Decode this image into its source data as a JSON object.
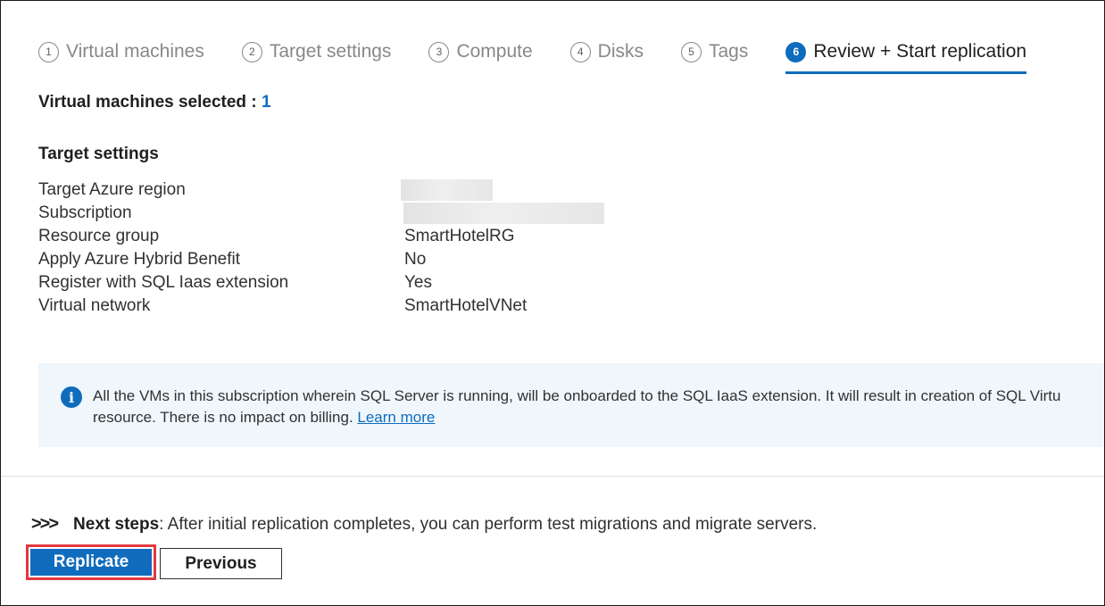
{
  "steps": [
    {
      "num": "1",
      "label": "Virtual machines"
    },
    {
      "num": "2",
      "label": "Target settings"
    },
    {
      "num": "3",
      "label": "Compute"
    },
    {
      "num": "4",
      "label": "Disks"
    },
    {
      "num": "5",
      "label": "Tags"
    },
    {
      "num": "6",
      "label": "Review + Start replication",
      "active": true
    }
  ],
  "summary": {
    "vm_selected_label": "Virtual machines selected : ",
    "vm_selected_count": "1"
  },
  "target_settings": {
    "title": "Target settings",
    "rows": [
      {
        "label": "Target Azure region",
        "value": ""
      },
      {
        "label": "Subscription",
        "value": ""
      },
      {
        "label": "Resource group",
        "value": "SmartHotelRG"
      },
      {
        "label": "Apply Azure Hybrid Benefit",
        "value": "No"
      },
      {
        "label": "Register with SQL Iaas extension",
        "value": "Yes"
      },
      {
        "label": "Virtual network",
        "value": "SmartHotelVNet"
      }
    ]
  },
  "info_banner": {
    "line1": "All the VMs in this subscription wherein SQL Server is running, will be onboarded to the SQL IaaS extension. It will result in creation of SQL Virtu",
    "line2": "resource. There is no impact on billing. ",
    "link": "Learn more"
  },
  "next_steps": {
    "icon": "chevrons-right-icon",
    "bold": "Next steps",
    "text": ": After initial replication completes, you can perform test migrations and migrate servers."
  },
  "buttons": {
    "replicate": "Replicate",
    "previous": "Previous"
  },
  "colors": {
    "accent": "#0f6cbd",
    "highlight_border": "#e3393f",
    "info_bg": "#eff6fc"
  }
}
